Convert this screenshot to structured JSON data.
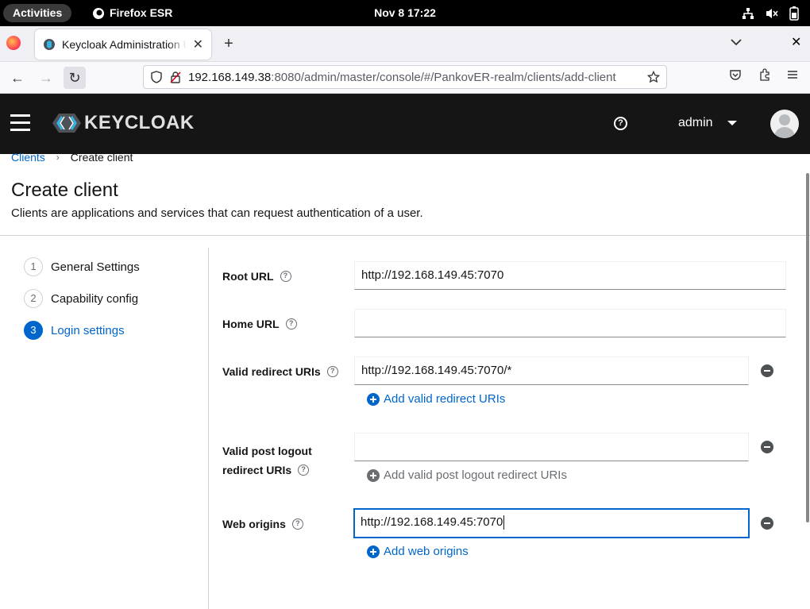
{
  "system_bar": {
    "activities": "Activities",
    "app_name": "Firefox ESR",
    "clock": "Nov 8  17:22",
    "tray_icons": [
      "network-icon",
      "volume-muted-icon",
      "battery-icon"
    ]
  },
  "browser": {
    "tab_title": "Keycloak Administration UI",
    "url_host": "192.168.149.38",
    "url_rest": ":8080/admin/master/console/#/PankovER-realm/clients/add-client"
  },
  "header": {
    "logo_text": "KEYCLOAK",
    "username": "admin"
  },
  "breadcrumb": {
    "parent": "Clients",
    "current": "Create client"
  },
  "page": {
    "title": "Create client",
    "description": "Clients are applications and services that can request authentication of a user."
  },
  "wizard": {
    "steps": [
      {
        "num": "1",
        "label": "General Settings"
      },
      {
        "num": "2",
        "label": "Capability config"
      },
      {
        "num": "3",
        "label": "Login settings"
      }
    ],
    "active_step": "3"
  },
  "form": {
    "root_url": {
      "label": "Root URL",
      "value": "http://192.168.149.45:7070"
    },
    "home_url": {
      "label": "Home URL",
      "value": ""
    },
    "redirect_uris": {
      "label": "Valid redirect URIs",
      "value": "http://192.168.149.45:7070/*",
      "add_label": "Add valid redirect URIs"
    },
    "post_logout": {
      "label_line1": "Valid post logout",
      "label_line2": "redirect URIs",
      "value": "",
      "add_label": "Add valid post logout redirect URIs"
    },
    "web_origins": {
      "label": "Web origins",
      "value": "http://192.168.149.45:7070",
      "add_label": "Add web origins"
    }
  },
  "colors": {
    "accent": "#0066cc",
    "header_bg": "#151515"
  }
}
